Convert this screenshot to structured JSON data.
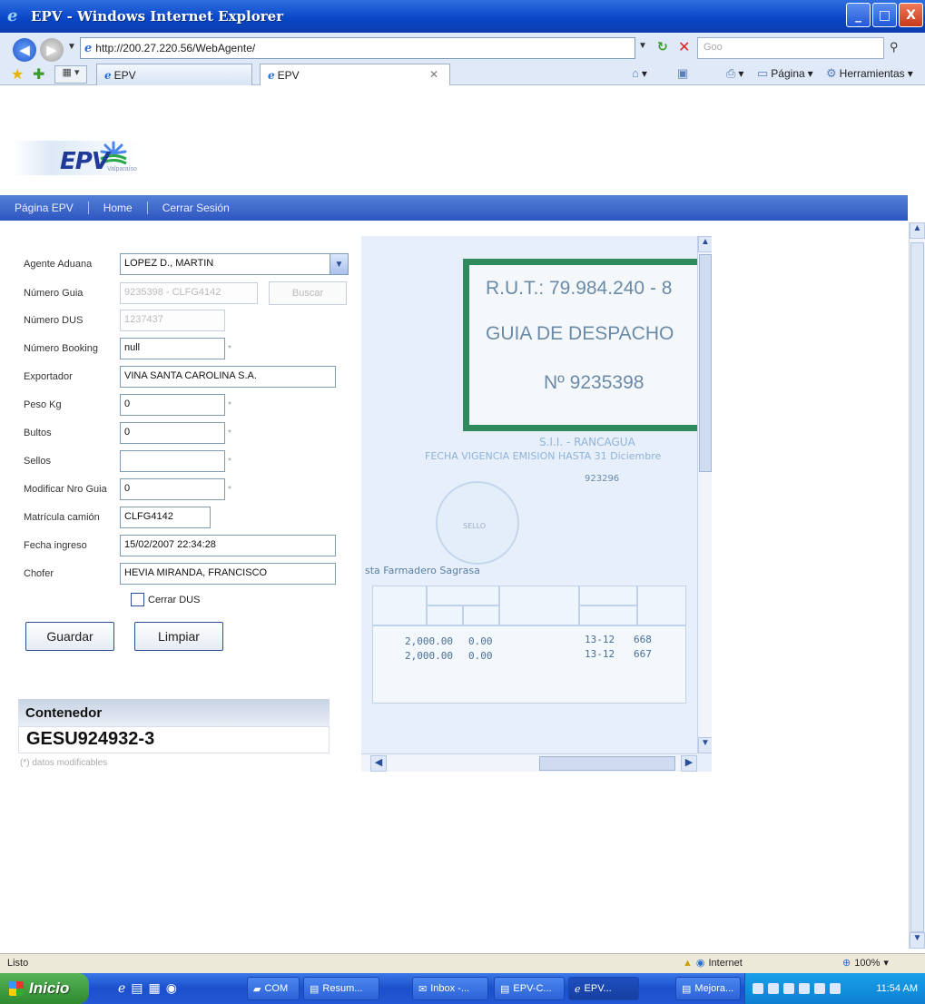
{
  "window": {
    "title": "EPV - Windows Internet Explorer",
    "buttons": {
      "minimize": "_",
      "maximize": "□",
      "close": "X"
    }
  },
  "addressbar": {
    "url": "http://200.27.220.56/WebAgente/",
    "search_placeholder": "Goo"
  },
  "tabs": [
    {
      "label": "EPV"
    },
    {
      "label": "EPV"
    }
  ],
  "commandbar": {
    "page_label": "Página",
    "tools_label": "Herramientas"
  },
  "site": {
    "logo_text": "EPV",
    "logo_sub": "Valparaíso",
    "nav": [
      "Página EPV",
      "Home",
      "Cerrar Sesión"
    ]
  },
  "form": {
    "agente_aduana": {
      "label": "Agente Aduana",
      "value": "LOPEZ D., MARTIN"
    },
    "numero_guia": {
      "label": "Número Guia",
      "value": "9235398 - CLFG4142"
    },
    "buscar_label": "Buscar",
    "numero_dus": {
      "label": "Número DUS",
      "value": "1237437"
    },
    "numero_booking": {
      "label": "Número Booking",
      "value": "null"
    },
    "exportador": {
      "label": "Exportador",
      "value": "VINA SANTA CAROLINA S.A."
    },
    "peso_kg": {
      "label": "Peso Kg",
      "value": "0"
    },
    "bultos": {
      "label": "Bultos",
      "value": "0"
    },
    "sellos": {
      "label": "Sellos",
      "value": ""
    },
    "modificar_nro_guia": {
      "label": "Modificar Nro Guia",
      "value": "0"
    },
    "matricula_camion": {
      "label": "Matrícula camión",
      "value": "CLFG4142"
    },
    "fecha_ingreso": {
      "label": "Fecha ingreso",
      "value": "15/02/2007 22:34:28"
    },
    "chofer": {
      "label": "Chofer",
      "value": "HEVIA MIRANDA, FRANCISCO"
    },
    "required_mark": "*",
    "cerrar_dus_label": "Cerrar DUS",
    "guardar_label": "Guardar",
    "limpiar_label": "Limpiar"
  },
  "contenedor": {
    "header": "Contenedor",
    "value": "GESU924932-3",
    "note": "(*) datos modificables"
  },
  "document": {
    "rut": "R.U.T.: 79.984.240 - 8",
    "guia": "GUIA DE DESPACHO",
    "numero": "Nº 9235398",
    "sii": "S.I.I. - RANCAGUA",
    "vigencia": "FECHA VIGENCIA EMISION HASTA 31 Diciembre",
    "code": "923296",
    "stamp_text": "SELLO",
    "client": "sta Farmadero Sagrasa",
    "rows": [
      {
        "qty": "2,000.00",
        "price": "0.00",
        "code": "13-12",
        "num": "668"
      },
      {
        "qty": "2,000.00",
        "price": "0.00",
        "code": "13-12",
        "num": "667"
      }
    ]
  },
  "status": {
    "text": "Listo",
    "zone": "Internet",
    "zoom": "100%"
  },
  "taskbar": {
    "start": "Inicio",
    "tasks": [
      "COM",
      "Resum...",
      "Inbox -...",
      "EPV-C...",
      "EPV...",
      "Mejora..."
    ],
    "clock": "11:54 AM"
  }
}
